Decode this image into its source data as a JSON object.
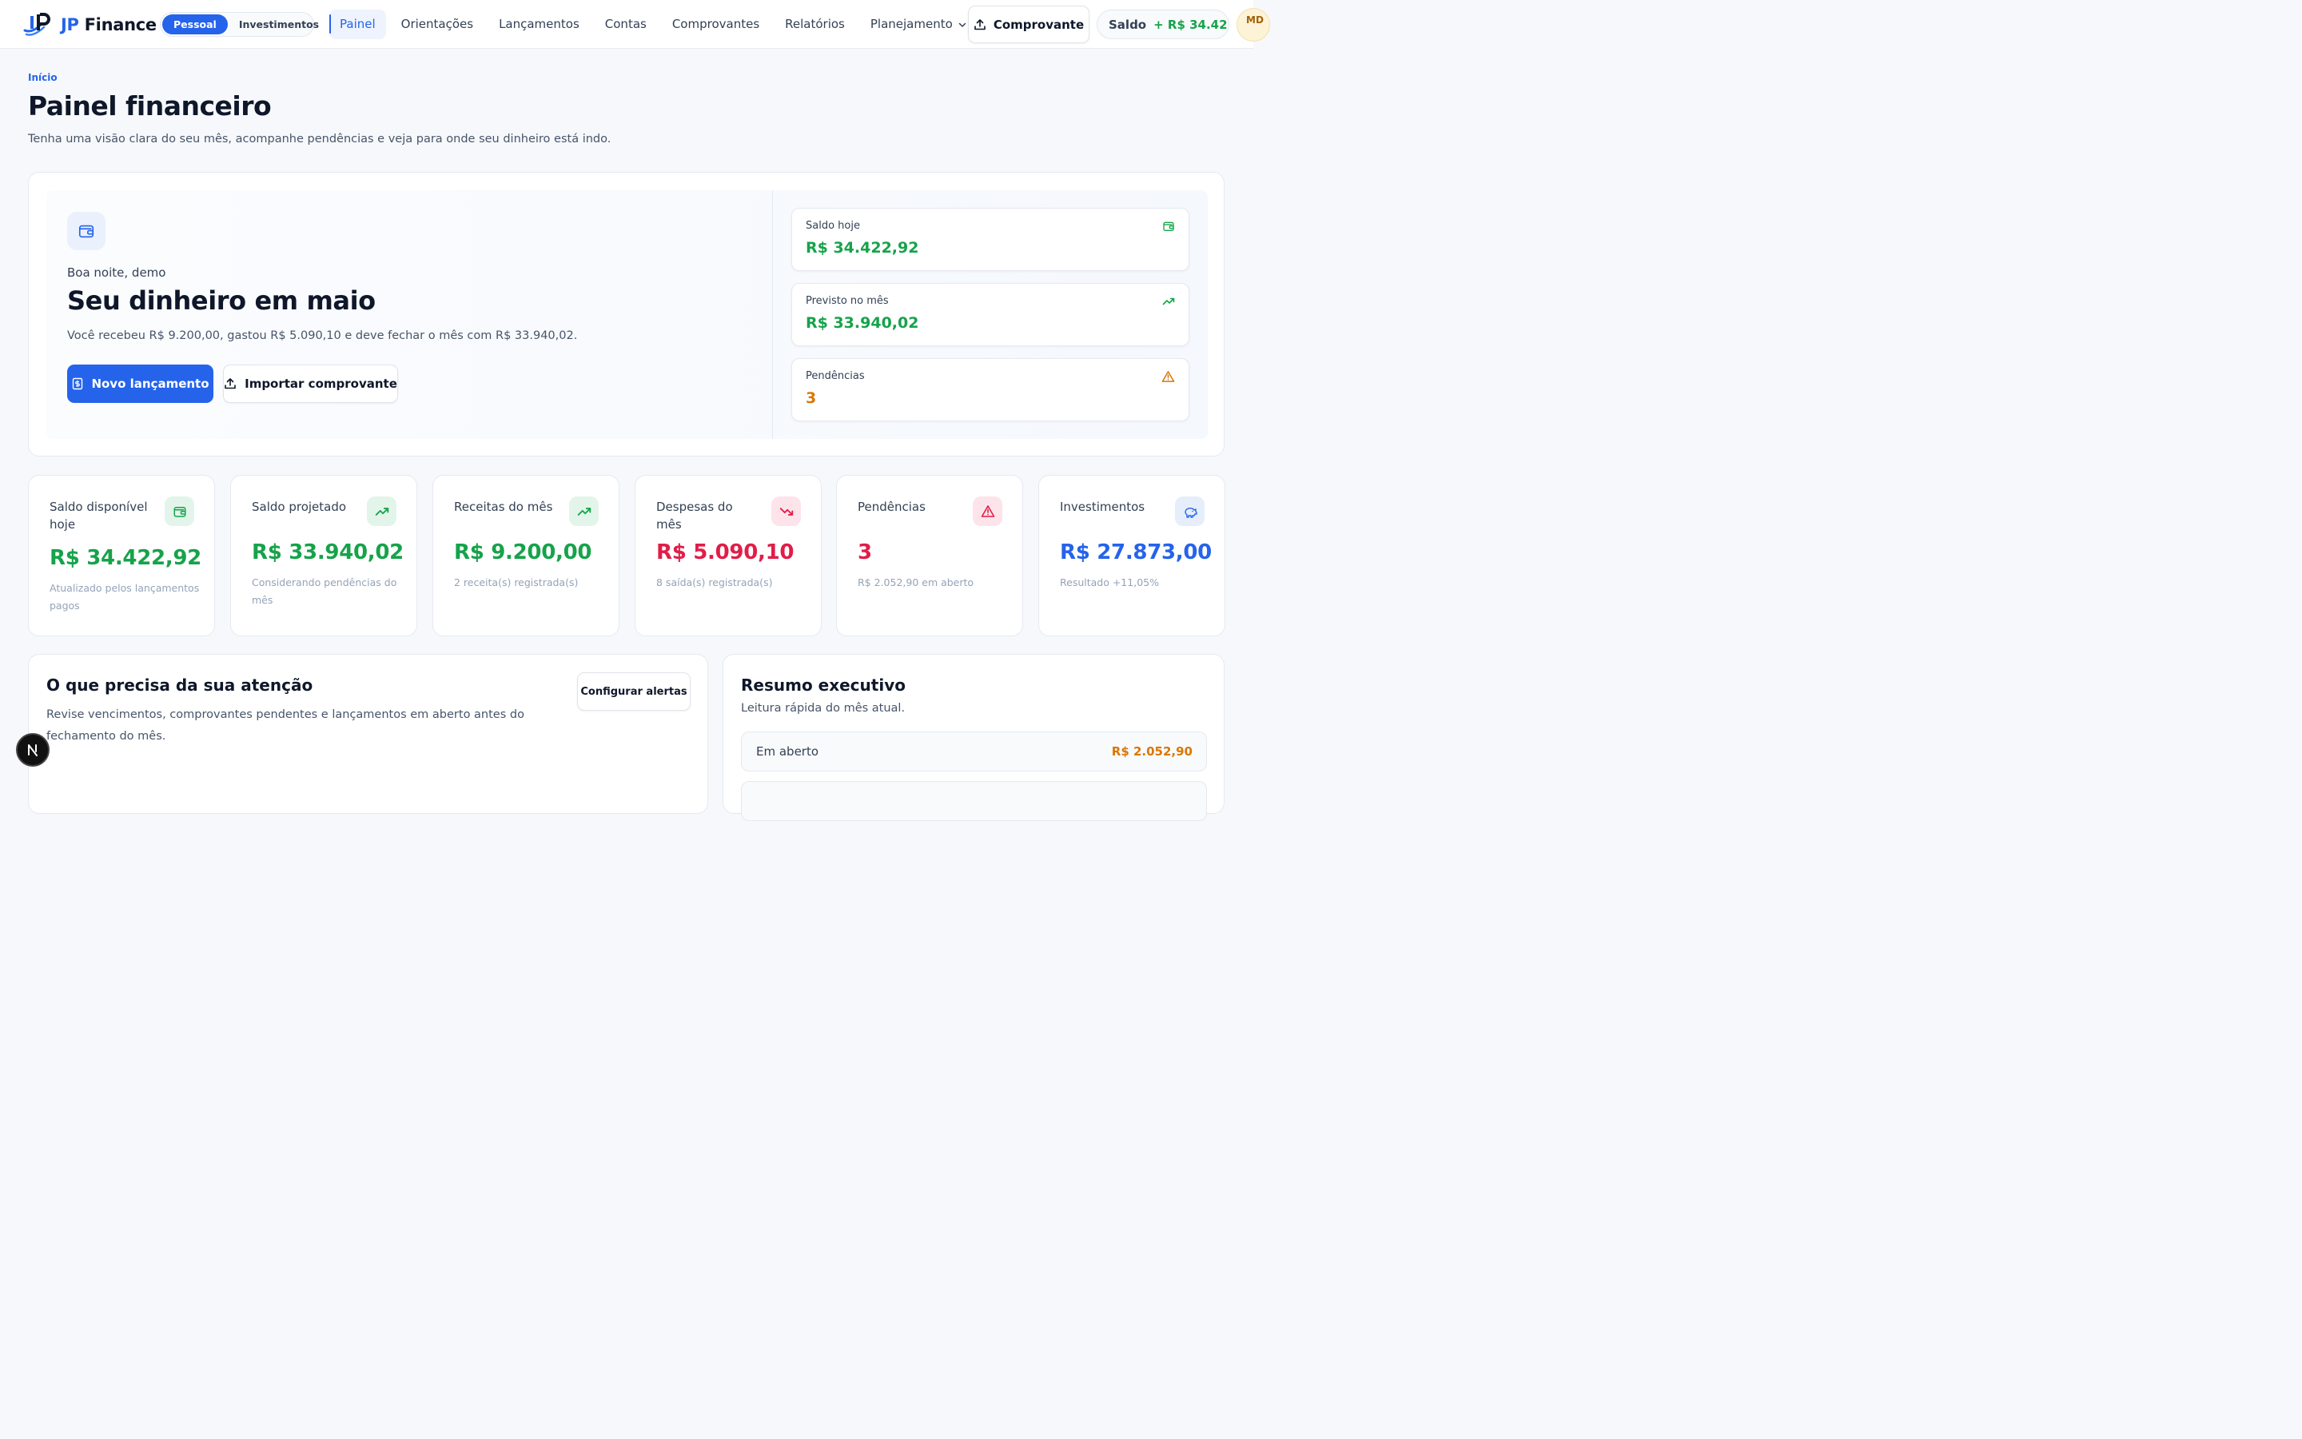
{
  "brand": {
    "prefix": "JP",
    "name": "Finance"
  },
  "mode_toggle": {
    "options": [
      "Pessoal",
      "Investimentos"
    ],
    "selected": "Pessoal"
  },
  "nav": {
    "items": [
      "Painel",
      "Orientações",
      "Lançamentos",
      "Contas",
      "Comprovantes",
      "Relatórios",
      "Planejamento"
    ],
    "active": "Painel"
  },
  "topbar": {
    "comprovante_label": "Comprovante",
    "saldo_label": "Saldo",
    "saldo_value": "+ R$ 34.42...",
    "avatar_initials": "MD"
  },
  "header": {
    "breadcrumb": "Início",
    "title": "Painel financeiro",
    "subtitle": "Tenha uma visão clara do seu mês, acompanhe pendências e veja para onde seu dinheiro está indo."
  },
  "hero": {
    "greeting": "Boa noite, demo",
    "title": "Seu dinheiro em maio",
    "description": "Você recebeu R$ 9.200,00, gastou R$ 5.090,10 e deve fechar o mês com R$ 33.940,02.",
    "primary_label": "Novo lançamento",
    "secondary_label": "Importar comprovante",
    "stats": [
      {
        "label": "Saldo hoje",
        "value": "R$ 34.422,92",
        "color": "#16a34a",
        "icon": "wallet-icon"
      },
      {
        "label": "Previsto no mês",
        "value": "R$ 33.940,02",
        "color": "#16a34a",
        "icon": "trending-up-icon"
      },
      {
        "label": "Pendências",
        "value": "3",
        "color": "#d97706",
        "icon": "warning-icon"
      }
    ]
  },
  "kpis": [
    {
      "label": "Saldo disponível hoje",
      "value": "R$ 34.422,92",
      "note": "Atualizado pelos lançamentos pagos",
      "color": "#16a34a",
      "icon": "wallet-icon"
    },
    {
      "label": "Saldo projetado",
      "value": "R$ 33.940,02",
      "note": "Considerando pendências do mês",
      "color": "#16a34a",
      "icon": "trending-up-icon"
    },
    {
      "label": "Receitas do mês",
      "value": "R$ 9.200,00",
      "note": "2 receita(s) registrada(s)",
      "color": "#16a34a",
      "icon": "trending-up-icon"
    },
    {
      "label": "Despesas do mês",
      "value": "R$ 5.090,10",
      "note": "8 saída(s) registrada(s)",
      "color": "#e11d48",
      "icon": "trending-down-icon"
    },
    {
      "label": "Pendências",
      "value": "3",
      "note": "R$ 2.052,90 em aberto",
      "color": "#e11d48",
      "icon": "alert-triangle-icon"
    },
    {
      "label": "Investimentos",
      "value": "R$ 27.873,00",
      "note": "Resultado +11,05%",
      "color": "#2563eb",
      "icon": "piggy-bank-icon"
    }
  ],
  "attention": {
    "title": "O que precisa da sua atenção",
    "description": "Revise vencimentos, comprovantes pendentes e lançamentos em aberto antes do fechamento do mês.",
    "button_label": "Configurar alertas"
  },
  "executive": {
    "title": "Resumo executivo",
    "description": "Leitura rápida do mês atual.",
    "rows": [
      {
        "label": "Em aberto",
        "value": "R$ 2.052,90"
      }
    ]
  }
}
